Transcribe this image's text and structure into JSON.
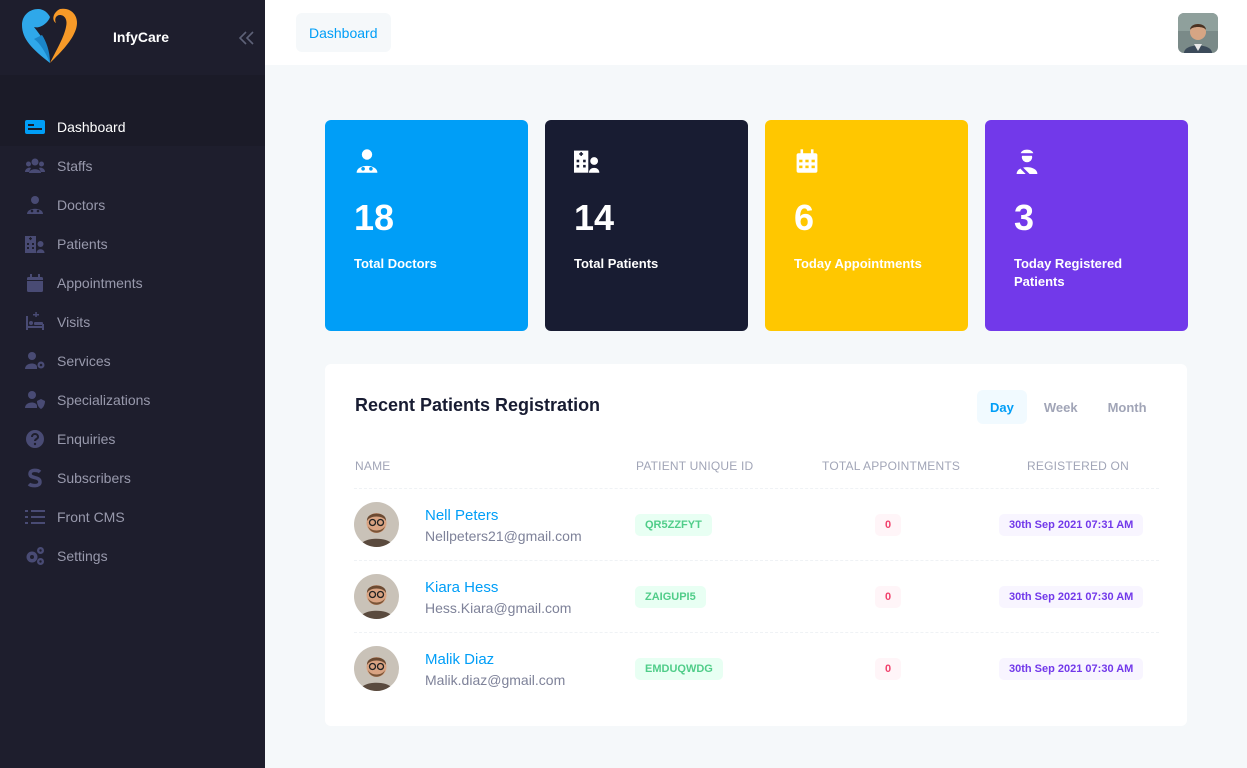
{
  "brand": {
    "name": "InfyCare"
  },
  "sidebar": {
    "items": [
      {
        "label": "Dashboard",
        "icon": "dashboard-icon",
        "active": true
      },
      {
        "label": "Staffs",
        "icon": "users-icon"
      },
      {
        "label": "Doctors",
        "icon": "doctor-icon"
      },
      {
        "label": "Patients",
        "icon": "hospital-user-icon"
      },
      {
        "label": "Appointments",
        "icon": "calendar-icon"
      },
      {
        "label": "Visits",
        "icon": "procedures-icon"
      },
      {
        "label": "Services",
        "icon": "user-cog-icon"
      },
      {
        "label": "Specializations",
        "icon": "user-shield-icon"
      },
      {
        "label": "Enquiries",
        "icon": "question-circle-icon"
      },
      {
        "label": "Subscribers",
        "icon": "subscriber-s-icon"
      },
      {
        "label": "Front CMS",
        "icon": "tasks-icon"
      },
      {
        "label": "Settings",
        "icon": "cogs-icon"
      }
    ]
  },
  "header": {
    "breadcrumb": "Dashboard"
  },
  "stats": [
    {
      "value": "18",
      "label": "Total Doctors",
      "color": "#009ef7",
      "icon": "doctor-icon"
    },
    {
      "value": "14",
      "label": "Total Patients",
      "color": "#181c32",
      "icon": "hospital-user-icon"
    },
    {
      "value": "6",
      "label": "Today Appointments",
      "color": "#ffc700",
      "icon": "calendar-icon"
    },
    {
      "value": "3",
      "label": "Today Registered Patients",
      "color": "#7239ea",
      "icon": "user-injured-icon"
    }
  ],
  "recent": {
    "title": "Recent Patients Registration",
    "tabs": [
      "Day",
      "Week",
      "Month"
    ],
    "active_tab": "Day",
    "columns": [
      "NAME",
      "PATIENT UNIQUE ID",
      "TOTAL APPOINTMENTS",
      "REGISTERED ON"
    ],
    "rows": [
      {
        "name": "Nell Peters",
        "email": "Nellpeters21@gmail.com",
        "uid": "QR5ZZFYT",
        "appointments": "0",
        "registered": "30th Sep 2021 07:31 AM"
      },
      {
        "name": "Kiara Hess",
        "email": "Hess.Kiara@gmail.com",
        "uid": "ZAIGUPI5",
        "appointments": "0",
        "registered": "30th Sep 2021 07:30 AM"
      },
      {
        "name": "Malik Diaz",
        "email": "Malik.diaz@gmail.com",
        "uid": "EMDUQWDG",
        "appointments": "0",
        "registered": "30th Sep 2021 07:30 AM"
      }
    ]
  }
}
